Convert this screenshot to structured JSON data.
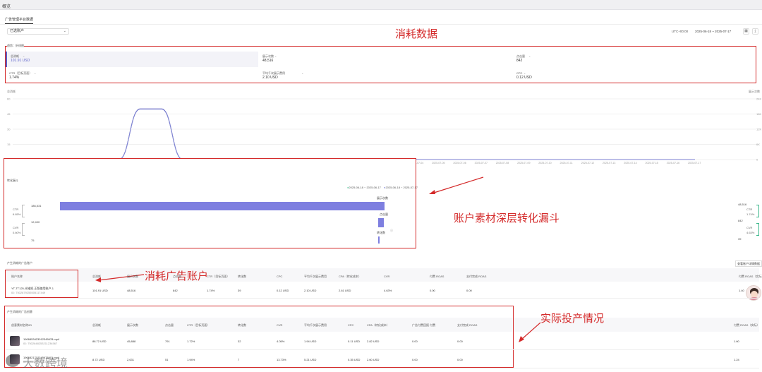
{
  "app": {
    "page_title": "概览",
    "tab": "广告管理平台数据"
  },
  "filters": {
    "account_select": "已选账户",
    "timezone": "UTC+00:00",
    "date_range": "2025-06-18 ~ 2025-07-17"
  },
  "annotations": {
    "consume_data": "消耗数据",
    "funnel": "账户素材深层转化漏斗",
    "ad_account": "消耗广告账户",
    "actual": "实际投产情况",
    "watermark": "大数跨境"
  },
  "trend": {
    "title": "趋势：折线图",
    "metrics": [
      {
        "label": "总消耗",
        "value": "101.91 USD",
        "active": true
      },
      {
        "label": "展示次数",
        "value": "48,516",
        "active": false
      },
      {
        "label": "点击量",
        "value": "842",
        "active": false
      },
      {
        "label": "CTR（目标页面）",
        "value": "1.74%",
        "active": false
      },
      {
        "label": "平均千次展示费用",
        "value": "2.10 USD",
        "active": false
      },
      {
        "label": "CPC",
        "value": "0.12 USD",
        "active": false
      }
    ],
    "left_axis_title": "总消耗",
    "right_axis_title": "展示次数",
    "y_left": [
      "60",
      "45",
      "30",
      "15",
      "0"
    ],
    "y_right": [
      "24K",
      "18K",
      "12K",
      "6K",
      "0"
    ]
  },
  "chart_data": {
    "type": "line",
    "x": [
      "2025-06-18",
      "2025-06-19",
      "2025-06-20",
      "2025-06-21",
      "2025-06-22",
      "2025-06-23",
      "2025-06-24",
      "2025-06-25",
      "2025-06-26",
      "2025-06-27",
      "2025-06-28",
      "2025-06-29",
      "2025-06-30",
      "2025-07-01",
      "2025-07-02",
      "2025-07-03",
      "2025-07-04",
      "2025-07-05",
      "2025-07-06",
      "2025-07-07",
      "2025-07-08",
      "2025-07-09",
      "2025-07-10",
      "2025-07-11",
      "2025-07-12",
      "2025-07-13",
      "2025-07-14",
      "2025-07-15",
      "2025-07-16",
      "2025-07-17"
    ],
    "series": [
      {
        "name": "总消耗",
        "axis": "left",
        "color": "#4a4fb8",
        "values": [
          0,
          0,
          0,
          50,
          50,
          0,
          0,
          0,
          0,
          0,
          0,
          0,
          0,
          0,
          0,
          0,
          0,
          0,
          0,
          0,
          0,
          0,
          0,
          0,
          0,
          0,
          0,
          0,
          0,
          0
        ]
      },
      {
        "name": "展示次数",
        "axis": "right",
        "color": "#8a8fd8",
        "values": [
          0,
          0,
          0,
          24250,
          24250,
          0,
          0,
          0,
          0,
          0,
          0,
          0,
          0,
          0,
          0,
          0,
          0,
          0,
          0,
          0,
          0,
          0,
          0,
          0,
          0,
          0,
          0,
          0,
          0,
          0
        ]
      }
    ],
    "ylim_left": [
      0,
      60
    ],
    "ylim_right": [
      0,
      24000
    ]
  },
  "funnel": {
    "title": "转化漏斗",
    "legend": [
      "2025-06-18 ~ 2025-06-17",
      "2025-06-18 ~ 2025-07-17"
    ],
    "rows": [
      {
        "label": "展示次数",
        "value_left": "186,531",
        "value_right": "48,516",
        "ratio": 1.0
      },
      {
        "label": "点击量",
        "value_left": "12,400",
        "value_right": "842",
        "ratio": 0.017
      },
      {
        "label": "转化数",
        "value_left": "75",
        "value_right": "39",
        "ratio": 0.002
      }
    ],
    "left_rates": [
      {
        "name": "CTR",
        "value": "6.65%"
      },
      {
        "name": "CVR",
        "value": "0.60%"
      }
    ],
    "right_rates": [
      {
        "name": "CTR",
        "value": "1.74%"
      },
      {
        "name": "CVR",
        "value": "4.63%"
      }
    ]
  },
  "accounts": {
    "title": "产生消耗的广告账户",
    "more_button": "查看账户详情数据",
    "columns": [
      "账户名称",
      "总消耗",
      "展示次数",
      "点击量",
      "CTR（目标页面）",
      "转化数",
      "CPC",
      "平均千次展示费用",
      "CPA（转化成本）",
      "CVR",
      "付费 ROAS",
      "支付完成 ROAS",
      "付费 ROAS（实际）"
    ],
    "rows": [
      {
        "name": "YT-TT125-光锥投-正版使用账户-1",
        "id": "ID: 7502879255505117449",
        "cells": [
          "101.91 USD",
          "48,516",
          "842",
          "1.74%",
          "39",
          "0.12 USD",
          "2.10 USD",
          "2.61 USD",
          "4.63%",
          "0.00",
          "0.00",
          "1.40"
        ]
      }
    ]
  },
  "ads": {
    "title": "产生消耗的广告创意",
    "columns": [
      "创意素材名称/ID",
      "总消耗",
      "展示次数",
      "点击量",
      "CTR（目标页面）",
      "转化数",
      "CVR",
      "平均千次展示费用",
      "CPC",
      "CPA（转化成本）",
      "广告付费回报 付费",
      "支付完成 ROAS",
      "付费 ROAS（实际）"
    ],
    "rows": [
      {
        "name": "1906853423012345678.mp4",
        "id": "ID: 7502648253211234567",
        "cells": [
          "88.72 USD",
          "45,888",
          "791",
          "1.72%",
          "32",
          "4.05%",
          "1.94 USD",
          "0.11 USD",
          "2.82 USD",
          "0.00",
          "0.00",
          "1.60"
        ]
      },
      {
        "name": "1906821712345678901.mp4",
        "id": "ID: 7502649011234567890",
        "cells": [
          "8.72 USD",
          "2,631",
          "51",
          "1.94%",
          "7",
          "13.73%",
          "5.21 USD",
          "0.35 USD",
          "2.60 USD",
          "0.00",
          "0.00",
          "1.24"
        ]
      }
    ]
  }
}
